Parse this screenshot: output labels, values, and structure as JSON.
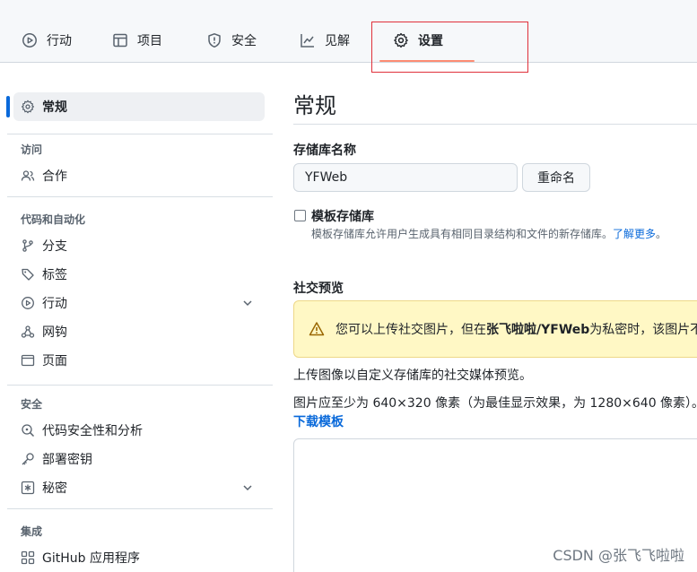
{
  "topnav": {
    "tabs": [
      {
        "label": "行动",
        "icon": "play-icon"
      },
      {
        "label": "项目",
        "icon": "table-icon"
      },
      {
        "label": "安全",
        "icon": "shield-icon"
      },
      {
        "label": "见解",
        "icon": "graph-icon"
      },
      {
        "label": "设置",
        "icon": "gear-icon",
        "selected": true
      }
    ],
    "accent": "#fd8c73",
    "highlight_color": "#e0303a"
  },
  "sidebar": {
    "general": "常规",
    "sections": {
      "access": "访问",
      "code_automation": "代码和自动化",
      "security": "安全",
      "integrations": "集成"
    },
    "items": {
      "collaborators": "合作",
      "branches": "分支",
      "tags": "标签",
      "actions": "行动",
      "webhooks": "网钩",
      "pages": "页面",
      "code_security": "代码安全性和分析",
      "deploy_keys": "部署密钥",
      "secrets": "秘密",
      "github_apps": "GitHub 应用程序"
    },
    "active_color": "#0969da"
  },
  "main": {
    "title": "常规",
    "repo_name_label": "存储库名称",
    "repo_name_value": "YFWeb",
    "rename_button": "重命名",
    "template_label": "模板存储库",
    "template_help": "模板存储库允许用户生成具有相同目录结构和文件的新存储库。",
    "learn_more": "了解更多",
    "help_end": "。",
    "social_preview_label": "社交预览",
    "flash_pre": "您可以上传社交图片，但在",
    "flash_bold": "张飞啦啦/YFWeb",
    "flash_post": "为私密时，该图片不会",
    "upload_text": "上传图像以自定义存储库的社交媒体预览。",
    "size_text": "图片应至少为 640×320 像素（为最佳显示效果，为 1280×640 像素）。",
    "download_template": "下载模板"
  },
  "watermark": "CSDN @张飞飞啦啦"
}
